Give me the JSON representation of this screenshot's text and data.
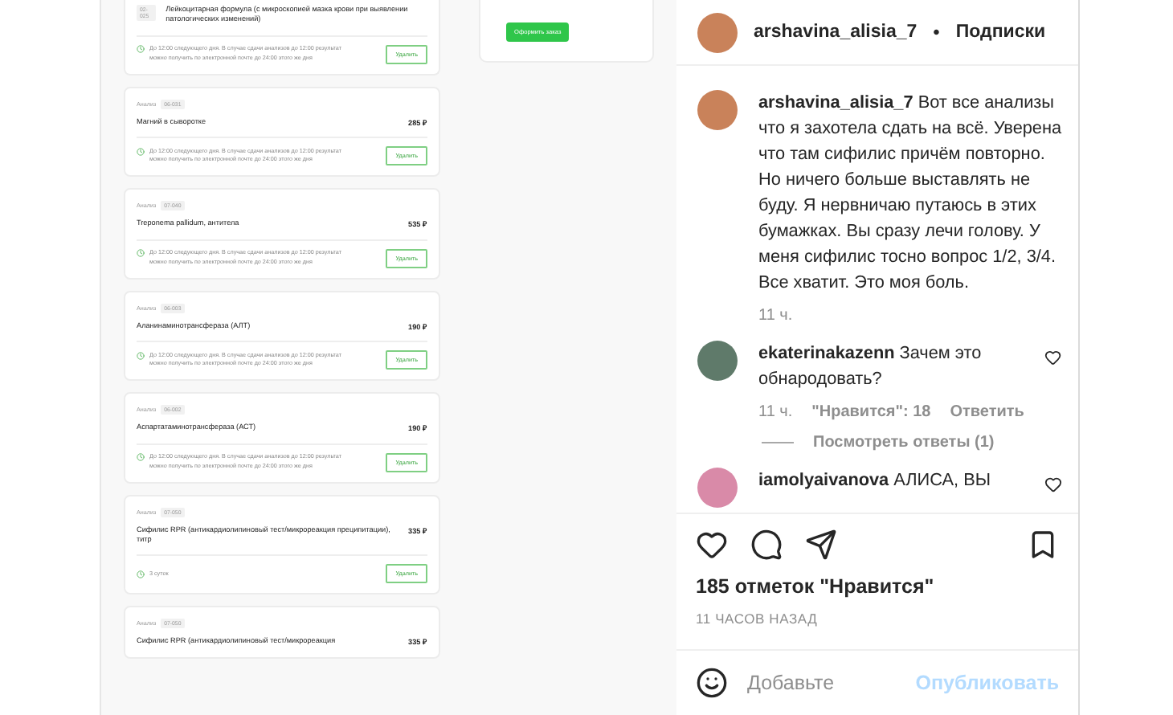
{
  "post_image": {
    "cards": [
      {
        "code": "02-025",
        "title": "Лейкоцитарная формула (с микроскопией мазка крови при выявлении патологических изменений)",
        "note": "До 12:00 следующего дня. В случае сдачи анализов до 12:00 результат можно получить по электронной почте до 24:00 этого же дня",
        "button": "Удалить"
      },
      {
        "label": "Анализ",
        "code": "06-031",
        "title": "Магний в сыворотке",
        "price": "285 ₽",
        "note": "До 12:00 следующего дня. В случае сдачи анализов до 12:00 результат можно получить по электронной почте до 24:00 этого же дня",
        "button": "Удалить"
      },
      {
        "label": "Анализ",
        "code": "07-040",
        "title": "Treponema pallidum, антитела",
        "price": "535 ₽",
        "note": "До 12:00 следующего дня. В случае сдачи анализов до 12:00 результат можно получить по электронной почте до 24:00 этого же дня",
        "button": "Удалить"
      },
      {
        "label": "Анализ",
        "code": "06-003",
        "title": "Аланинаминотрансфераза (АЛТ)",
        "price": "190 ₽",
        "note": "До 12:00 следующего дня. В случае сдачи анализов до 12:00 результат можно получить по электронной почте до 24:00 этого же дня",
        "button": "Удалить"
      },
      {
        "label": "Анализ",
        "code": "06-002",
        "title": "Аспартатаминотрансфераза (АСТ)",
        "price": "190 ₽",
        "note": "До 12:00 следующего дня. В случае сдачи анализов до 12:00 результат можно получить по электронной почте до 24:00 этого же дня",
        "button": "Удалить"
      },
      {
        "label": "Анализ",
        "code": "07-050",
        "title": "Сифилис RPR (антикардиолипиновый тест/микрореакция преципитации), титр",
        "price": "335 ₽",
        "note": "3 суток",
        "button": "Удалить"
      },
      {
        "label": "Анализ",
        "code": "07-050",
        "title": "Сифилис RPR (антикардиолипиновый тест/микрореакция",
        "price": "335 ₽"
      }
    ],
    "order_button": "Оформить заказ"
  },
  "header": {
    "username": "arshavina_alisia_7",
    "separator": "•",
    "follow": "Подписки"
  },
  "comments": [
    {
      "username": "arshavina_alisia_7",
      "text": "Вот все анализы что я захотела сдать на всё. Уверена что там сифилис причём повторно. Но ничего больше выставлять не буду. Я нервничаю путаюсь в этих бумажках. Вы сразу лечи голову. У меня сифилис тосно вопрос 1/2, 3/4. Все хватит. Это моя боль.",
      "time": "11 ч.",
      "color": "#c9825a"
    },
    {
      "username": "ekaterinakazenn",
      "text": "Зачем это обнародовать?",
      "time": "11 ч.",
      "likes": "\"Нравится\": 18",
      "reply": "Ответить",
      "view_replies": "Посмотреть ответы (1)",
      "color": "#5f7a6a"
    },
    {
      "username": "iamolyaivanova",
      "text": "АЛИСА, ВЫ",
      "color": "#d98aa8"
    }
  ],
  "likes": "185 отметок \"Нравится\"",
  "posted": "11 ЧАСОВ НАЗАД",
  "add_comment": {
    "placeholder": "Добавьте",
    "button": "Опубликовать"
  }
}
